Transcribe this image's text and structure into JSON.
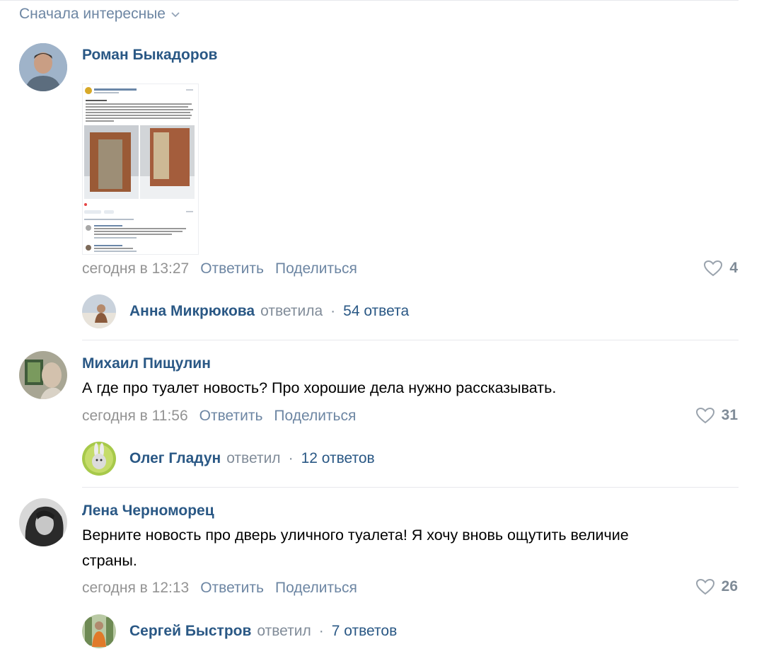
{
  "sort": {
    "label": "Сначала интересные"
  },
  "comments": [
    {
      "author": "Роман Быкадоров",
      "text": "",
      "time": "сегодня в 13:27",
      "reply_label": "Ответить",
      "share_label": "Поделиться",
      "likes": "4",
      "thread": {
        "name": "Анна Микрюкова",
        "action": "ответила",
        "count": "54 ответа"
      }
    },
    {
      "author": "Михаил Пищулин",
      "text": "А где про туалет новость? Про хорошие дела нужно рассказывать.",
      "time": "сегодня в 11:56",
      "reply_label": "Ответить",
      "share_label": "Поделиться",
      "likes": "31",
      "thread": {
        "name": "Олег Гладун",
        "action": "ответил",
        "count": "12 ответов"
      }
    },
    {
      "author": "Лена Черноморец",
      "text": "Верните новость про дверь уличного туалета! Я хочу вновь ощутить величие страны.",
      "time": "сегодня в 12:13",
      "reply_label": "Ответить",
      "share_label": "Поделиться",
      "likes": "26",
      "thread": {
        "name": "Сергей Быстров",
        "action": "ответил",
        "count": "7 ответов"
      }
    }
  ],
  "colors": {
    "link": "#2a5885",
    "secondary_link": "#6d86a3",
    "meta": "#939393",
    "separator": "#e7e8ec"
  },
  "icons": [
    "chevron-down-icon",
    "heart-icon"
  ]
}
